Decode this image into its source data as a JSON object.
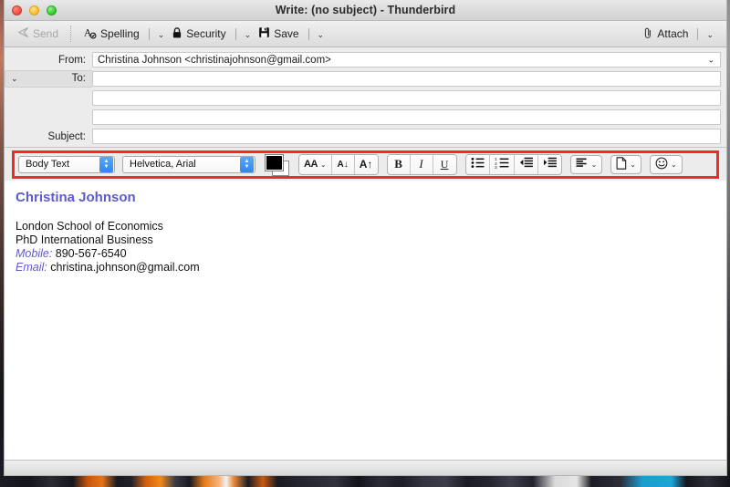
{
  "window": {
    "title": "Write: (no subject) - Thunderbird",
    "traffic_lights": [
      "close",
      "minimize",
      "zoom"
    ]
  },
  "toolbar": {
    "send_label": "Send",
    "spelling_label": "Spelling",
    "security_label": "Security",
    "save_label": "Save",
    "attach_label": "Attach",
    "chevron": "⌄"
  },
  "headers": {
    "from_label": "From:",
    "from_value": "Christina Johnson <christinajohnson@gmail.com>",
    "to_label": "To:",
    "to_value": "",
    "recipient2_value": "",
    "recipient3_value": "",
    "subject_label": "Subject:",
    "subject_value": ""
  },
  "format_toolbar": {
    "highlight_color": "#ef2b24",
    "paragraph_style": "Body Text",
    "font_family": "Helvetica, Arial",
    "foreground_color": "#000000",
    "background_color": "#ffffff",
    "font_size_label": "AA",
    "font_smaller_label": "A↓",
    "font_larger_label": "A↑",
    "bold_label": "B",
    "italic_label": "I",
    "underline_label": "U",
    "bullet_list": "bulleted-list",
    "numbered_list": "numbered-list",
    "outdent": "outdent",
    "indent": "indent",
    "align": "align",
    "insert": "insert",
    "emoji": "☺"
  },
  "message_body": {
    "signature_name": "Christina Johnson",
    "line_org": "London School of Economics",
    "line_title": "PhD International Business",
    "mobile_label": "Mobile:",
    "mobile_value": "890-567-6540",
    "email_label": "Email:",
    "email_value": "christina.johnson@gmail.com"
  }
}
